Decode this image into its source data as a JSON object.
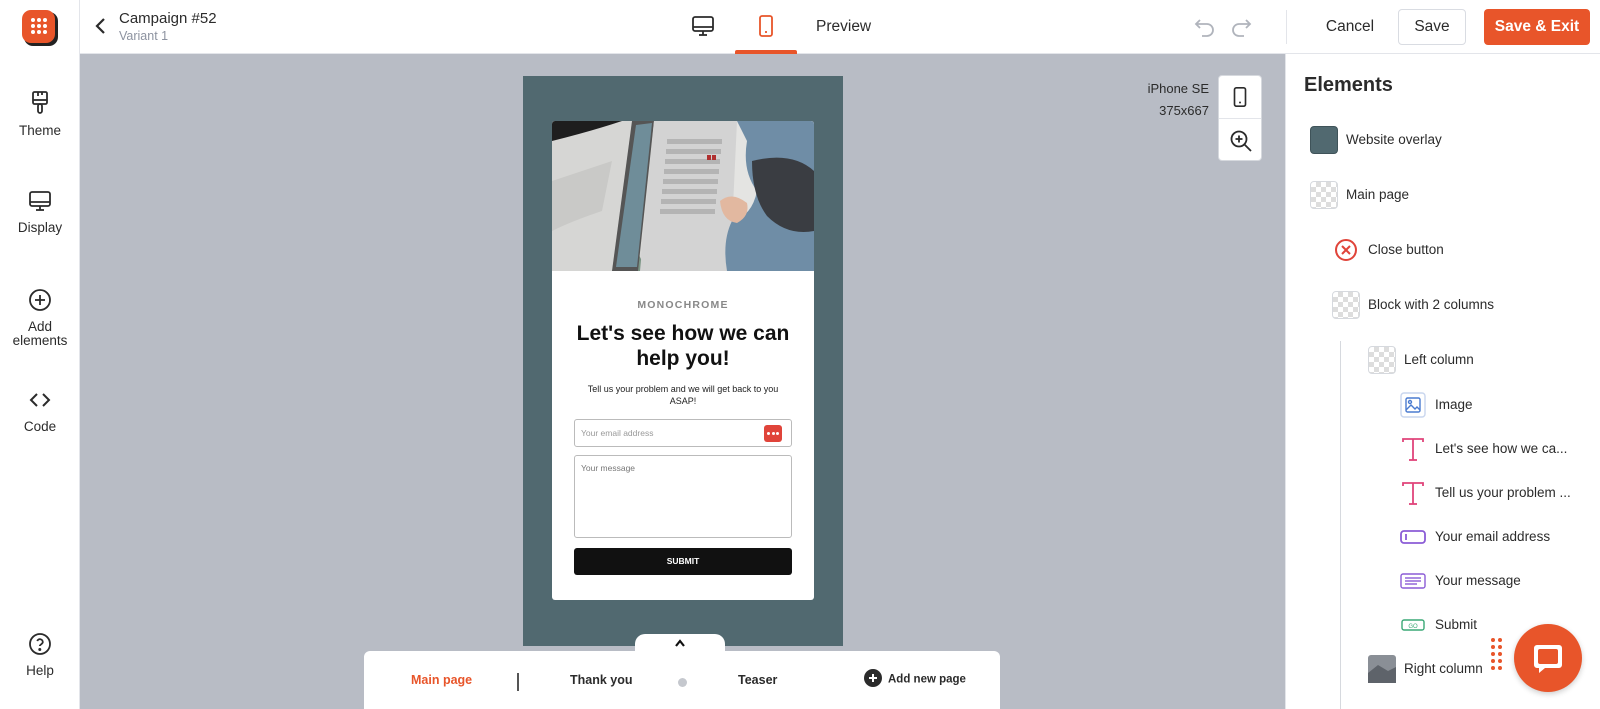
{
  "topbar": {
    "title": "Campaign #52",
    "subtitle": "Variant 1",
    "preview_label": "Preview",
    "cancel_label": "Cancel",
    "save_label": "Save",
    "save_exit_label": "Save & Exit",
    "active_device": "mobile"
  },
  "rail": {
    "items": [
      {
        "label": "Theme",
        "icon": "paintbrush-icon"
      },
      {
        "label": "Display",
        "icon": "monitor-icon"
      },
      {
        "label": "Add elements",
        "icon": "plus-circle-icon"
      },
      {
        "label": "Code",
        "icon": "code-icon"
      },
      {
        "label": "Help",
        "icon": "help-circle-icon"
      }
    ]
  },
  "canvas": {
    "device_name": "iPhone SE",
    "device_size": "375x667",
    "popup": {
      "brand": "MONOCHROME",
      "headline": "Let's see how we can help you!",
      "subtext": "Tell us your problem and we will get back to you ASAP!",
      "email_placeholder": "Your email address",
      "message_placeholder": "Your message",
      "submit_label": "SUBMIT"
    }
  },
  "pages": {
    "tabs": [
      {
        "label": "Main page",
        "active": true
      },
      {
        "label": "Thank you",
        "active": false
      },
      {
        "label": "Teaser",
        "active": false
      }
    ],
    "add_label": "Add new page"
  },
  "panel": {
    "title": "Elements",
    "items": [
      {
        "label": "Website overlay",
        "icon": "color-swatch-icon"
      },
      {
        "label": "Main page",
        "icon": "transparent-icon"
      },
      {
        "label": "Close button",
        "icon": "close-circle-icon"
      },
      {
        "label": "Block with 2 columns",
        "icon": "transparent-icon"
      },
      {
        "label": "Left column",
        "icon": "transparent-icon"
      },
      {
        "label": "Image",
        "icon": "image-icon"
      },
      {
        "label": "Let's see how we ca...",
        "icon": "text-icon"
      },
      {
        "label": "Tell us your problem ...",
        "icon": "text-icon"
      },
      {
        "label": "Your email address",
        "icon": "input-icon"
      },
      {
        "label": "Your message",
        "icon": "textarea-icon"
      },
      {
        "label": "Submit",
        "icon": "button-icon"
      },
      {
        "label": "Right column",
        "icon": "image-thumb-icon"
      }
    ]
  },
  "colors": {
    "accent": "#e8552a",
    "overlay": "#516970",
    "canvas_bg": "#b8bcc5"
  }
}
